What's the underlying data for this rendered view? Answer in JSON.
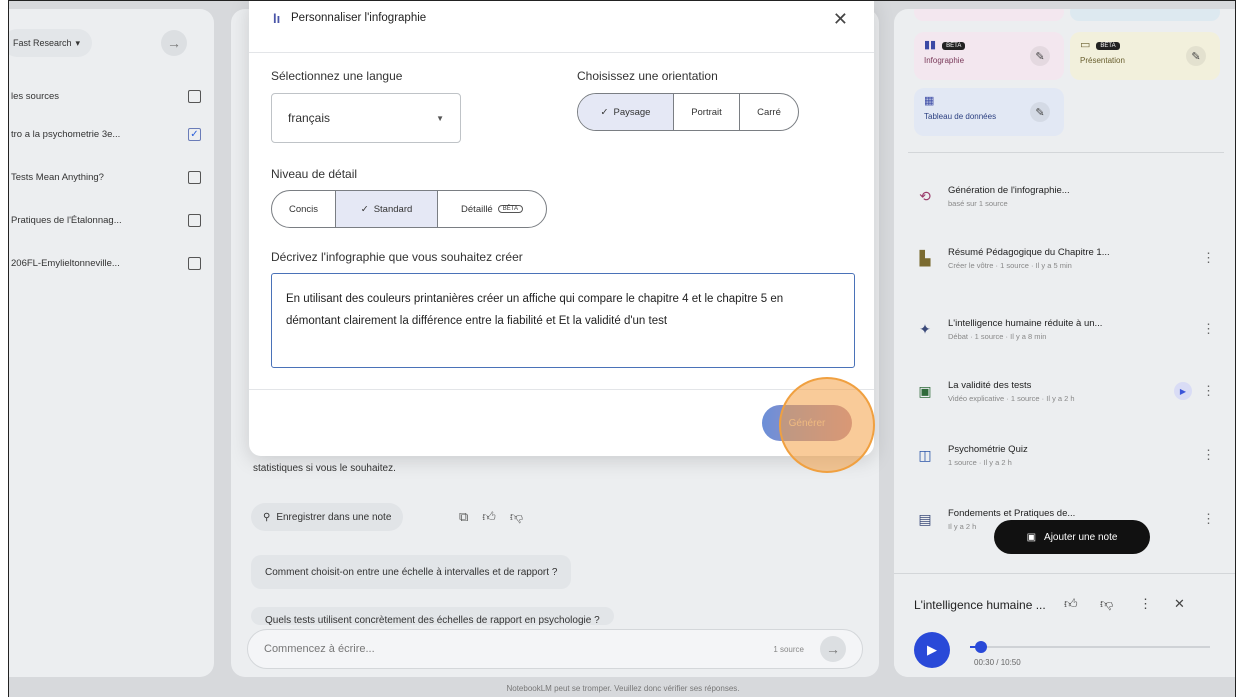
{
  "left": {
    "mode_chip": "Fast Research",
    "sources": [
      {
        "label": "les sources",
        "checked": false
      },
      {
        "label": "tro a la psychometrie 3e...",
        "checked": true
      },
      {
        "label": "Tests Mean Anything?",
        "checked": false
      },
      {
        "label": "Pratiques de l'Étalonnag...",
        "checked": false
      },
      {
        "label": "206FL-Emylieltonneville...",
        "checked": false
      }
    ]
  },
  "chat": {
    "message_tail": "statistiques si vous le souhaitez.",
    "save_note": "Enregistrer dans une note",
    "suggestions": [
      "Comment choisit-on entre une échelle à intervalles et de rapport ?",
      "Quels tests utilisent concrètement des échelles de rapport en psychologie ?"
    ],
    "input_placeholder": "Commencez à écrire...",
    "source_count": "1 source",
    "disclaimer": "NotebookLM peut se tromper. Veuillez donc vérifier ses réponses."
  },
  "modal": {
    "title": "Personnaliser l'infographie",
    "language_label": "Sélectionnez une langue",
    "language_value": "français",
    "orientation_label": "Choisissez une orientation",
    "orientations": [
      "Paysage",
      "Portrait",
      "Carré"
    ],
    "orientation_selected": "Paysage",
    "detail_label": "Niveau de détail",
    "details": [
      "Concis",
      "Standard",
      "Détaillé"
    ],
    "detail_selected": "Standard",
    "beta": "BÊTA",
    "describe_label": "Décrivez l'infographie que vous souhaitez créer",
    "description": "En utilisant des couleurs printanières créer un affiche qui compare le chapitre 4 et le chapitre 5 en démontant clairement la différence entre la fiabilité et Et la validité d'un test",
    "generate": "Générer"
  },
  "studio": {
    "tiles": [
      {
        "name": "Infographie",
        "badge": "BÊTA",
        "bg": "#f3e7ef"
      },
      {
        "name": "Présentation",
        "badge": "BÊTA",
        "bg": "#f2f0dc"
      },
      {
        "name": "Tableau de données",
        "badge": "",
        "bg": "#e2e8f4"
      }
    ],
    "items": [
      {
        "title": "Génération de l'infographie...",
        "sub": "basé sur 1 source"
      },
      {
        "title": "Résumé Pédagogique du Chapitre 1...",
        "sub": "Créer le vôtre · 1 source · Il y a 5 min"
      },
      {
        "title": "L'intelligence humaine réduite à un...",
        "sub": "Débat · 1 source · Il y a 8 min"
      },
      {
        "title": "La validité des tests",
        "sub": "Vidéo explicative · 1 source · Il y a 2 h"
      },
      {
        "title": "Psychométrie Quiz",
        "sub": "1 source · Il y a 2 h"
      },
      {
        "title": "Fondements et Pratiques de...",
        "sub": "Il y a 2 h"
      }
    ],
    "add_note": "Ajouter une note",
    "player_title": "L'intelligence humaine ...",
    "player_time": "00:30 / 10:50",
    "player_progress": 0.046
  }
}
